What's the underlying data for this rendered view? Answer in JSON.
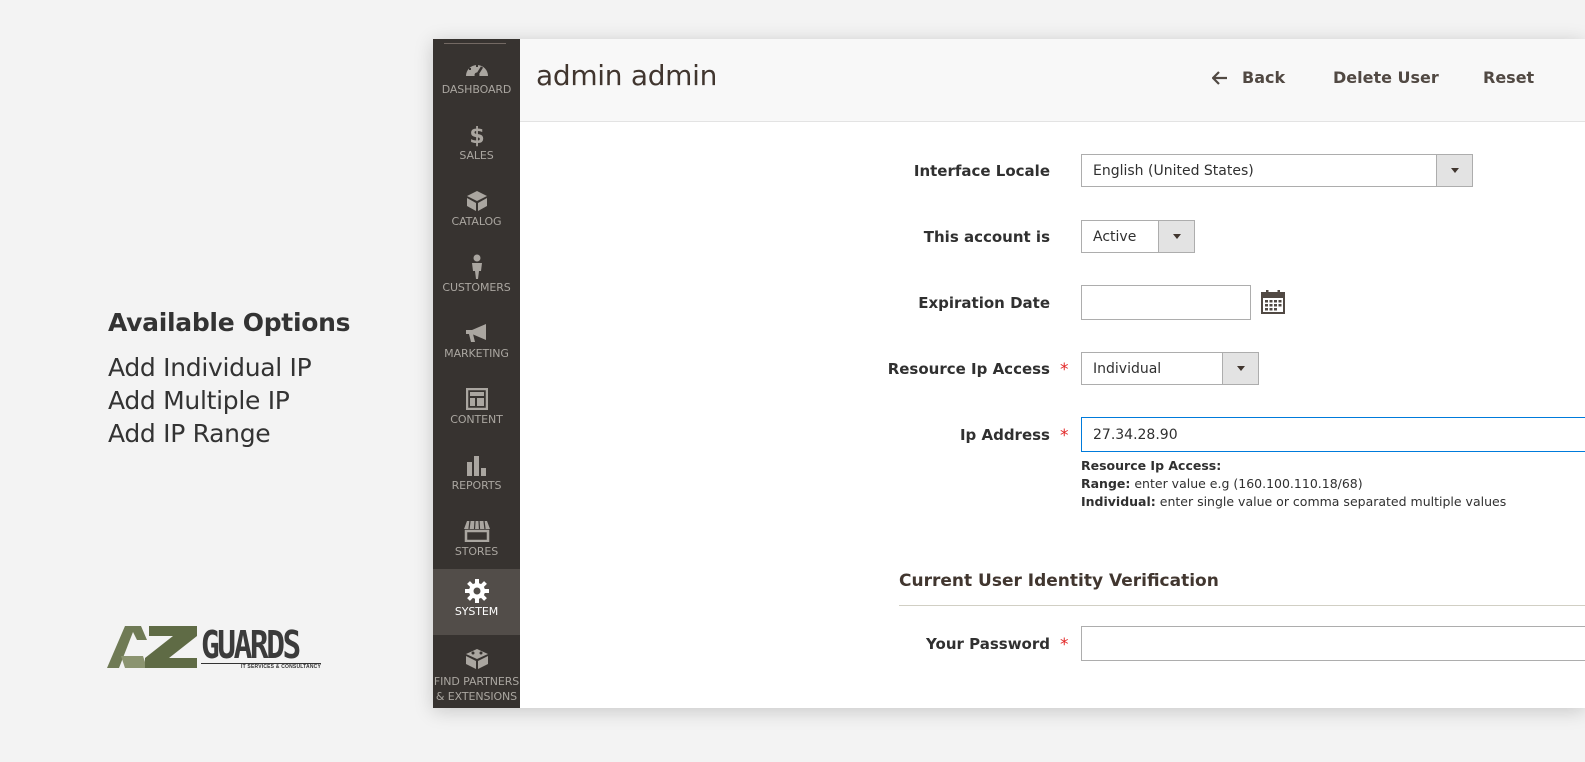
{
  "promo": {
    "heading": "Available Options",
    "options": [
      "Add Individual IP",
      "Add Multiple IP",
      "Add IP Range"
    ]
  },
  "brand": {
    "name": "GUARDS",
    "mark_letters": "AZ",
    "tagline": "IT SERVICES & CONSULTANCY"
  },
  "sidebar": {
    "items": [
      {
        "label": "DASHBOARD",
        "icon": "dashboard-icon",
        "active": false
      },
      {
        "label": "SALES",
        "icon": "dollar-icon",
        "active": false
      },
      {
        "label": "CATALOG",
        "icon": "box-icon",
        "active": false
      },
      {
        "label": "CUSTOMERS",
        "icon": "person-icon",
        "active": false
      },
      {
        "label": "MARKETING",
        "icon": "megaphone-icon",
        "active": false
      },
      {
        "label": "CONTENT",
        "icon": "layout-icon",
        "active": false
      },
      {
        "label": "REPORTS",
        "icon": "bar-chart-icon",
        "active": false
      },
      {
        "label": "STORES",
        "icon": "storefront-icon",
        "active": false
      },
      {
        "label": "SYSTEM",
        "icon": "gear-icon",
        "active": true
      },
      {
        "label": "FIND PARTNERS\n& EXTENSIONS",
        "label_line1": "FIND PARTNERS",
        "label_line2": "& EXTENSIONS",
        "icon": "blocks-icon",
        "active": false
      }
    ]
  },
  "header": {
    "title": "admin admin",
    "back_label": "Back",
    "delete_label": "Delete User",
    "reset_label": "Reset"
  },
  "form": {
    "interface_locale": {
      "label": "Interface Locale",
      "value": "English (United States)"
    },
    "account_status": {
      "label": "This account is",
      "value": "Active"
    },
    "expiration_date": {
      "label": "Expiration Date",
      "value": ""
    },
    "resource_ip_access": {
      "label": "Resource Ip Access",
      "value": "Individual"
    },
    "ip_address": {
      "label": "Ip Address",
      "value": "27.34.28.90"
    },
    "note": {
      "title": "Resource Ip Access:",
      "range_label": "Range:",
      "range_text": " enter value e.g (160.100.110.18/68)",
      "individual_label": "Individual:",
      "individual_text": " enter single value or comma separated multiple values"
    },
    "required_mark": "*"
  },
  "verification": {
    "section_title": "Current User Identity Verification",
    "password_label": "Your Password",
    "password_value": ""
  },
  "colors": {
    "sidebar_bg": "#373330",
    "sidebar_active": "#524d49",
    "required": "#e22626",
    "focus_border": "#007bdb",
    "brand_green": "#6f7a55"
  }
}
